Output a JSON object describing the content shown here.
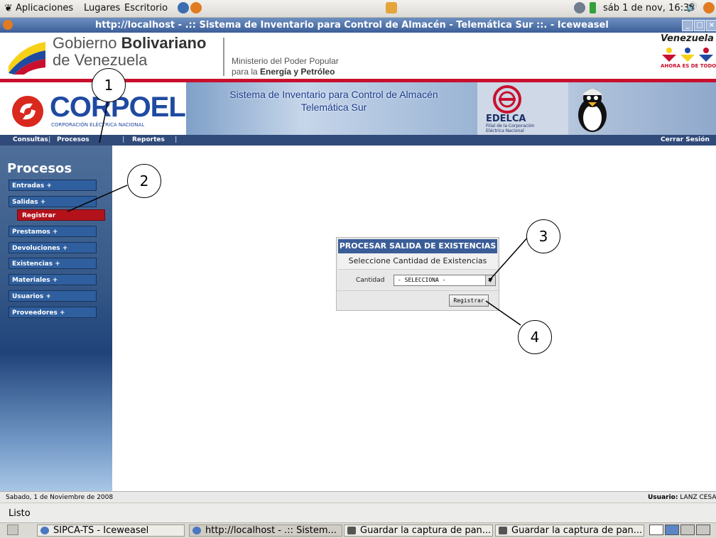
{
  "desktop": {
    "menus": [
      "Aplicaciones",
      "Lugares",
      "Escritorio"
    ],
    "clock": "sáb 1 de nov, 16:33"
  },
  "window": {
    "title": "http://localhost - .:: Sistema de Inventario para Control de Almacén - Telemática Sur ::. - Iceweasel"
  },
  "gov_header": {
    "line1_light": "Gobierno ",
    "line1_bold": "Bolivariano",
    "line2": "de Venezuela",
    "ministry_line1": "Ministerio del Poder Popular",
    "ministry_line2_light": "para la ",
    "ministry_line2_bold": "Energía y Petróleo",
    "right_title": "Venezuela",
    "right_caption": "AHORA ES DE TODOS"
  },
  "banner": {
    "logo_text": "CORPOELEC",
    "logo_subtitle": "CORPORACIÓN ELÉCTRICA NACIONAL",
    "app_title_line1": "Sistema de Inventario para Control de Almacén",
    "app_title_line2": "Telemática Sur",
    "edelca_name": "EDELCA",
    "edelca_line1": "Filial de la Corporación",
    "edelca_line2": "Eléctrica Nacional"
  },
  "nav": {
    "items": [
      "Consultas",
      "Procesos",
      "Reportes"
    ],
    "logout": "Cerrar Sesión"
  },
  "sidebar": {
    "heading": "Procesos",
    "items": [
      {
        "label": "Entradas +"
      },
      {
        "label": "Salidas +"
      },
      {
        "label": "Registrar"
      },
      {
        "label": "Prestamos +"
      },
      {
        "label": "Devoluciones +"
      },
      {
        "label": "Existencias +"
      },
      {
        "label": "Materiales +"
      },
      {
        "label": "Usuarios +"
      },
      {
        "label": "Proveedores +"
      }
    ]
  },
  "form": {
    "header": "PROCESAR SALIDA DE EXISTENCIAS",
    "subtitle": "Seleccione Cantidad de Existencias",
    "quantity_label": "Cantidad",
    "select_value": "- SELECCIONA -",
    "submit_label": "Registrar"
  },
  "status": {
    "date": "Sabado, 1 de Noviembre de 2008",
    "user_label": "Usuario:",
    "user_value": "LANZ CESAR",
    "browser_status": "Listo"
  },
  "taskbar": {
    "tasks": [
      "SIPCA-TS - Iceweasel",
      "http://localhost - .:: Sistem...",
      "Guardar la captura de pan...",
      "Guardar la captura de pan..."
    ]
  },
  "callouts": [
    "1",
    "2",
    "3",
    "4"
  ],
  "colors": {
    "gov_red": "#c8102e",
    "corpoelec_blue": "#1f4aa0",
    "nav_bg": "#304a7a",
    "menu_item_bg": "#2f5f9e",
    "active_item_bg": "#b3121b",
    "form_header_bg": "#3a5d98"
  }
}
